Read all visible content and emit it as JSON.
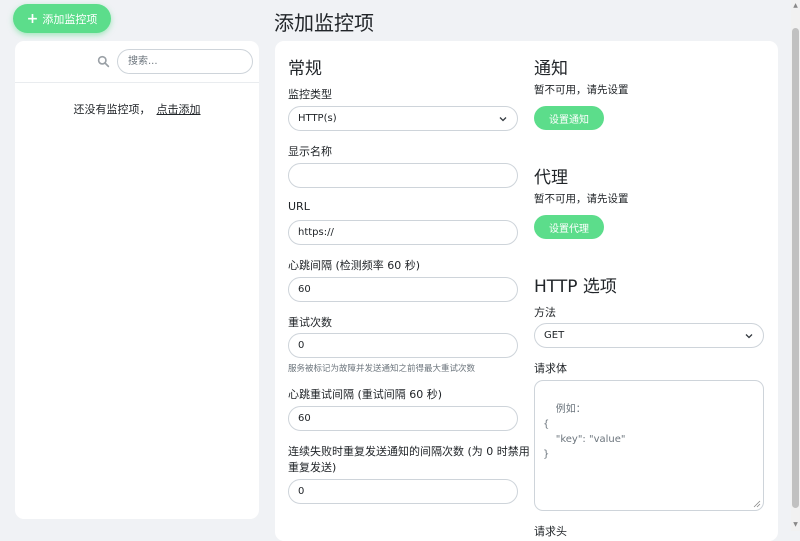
{
  "add_button": {
    "icon": "plus-icon",
    "label": "添加监控项"
  },
  "sidebar": {
    "search_placeholder": "搜索...",
    "empty_text": "还没有监控项，",
    "empty_link": "点击添加"
  },
  "page_title": "添加监控项",
  "general": {
    "heading": "常规",
    "monitor_type": {
      "label": "监控类型",
      "value": "HTTP(s)"
    },
    "display_name": {
      "label": "显示名称",
      "value": ""
    },
    "url": {
      "label": "URL",
      "value": "https://"
    },
    "interval": {
      "label": "心跳间隔 (检测频率 60 秒)",
      "value": "60"
    },
    "retries": {
      "label": "重试次数",
      "value": "0",
      "help": "服务被标记为故障并发送通知之前得最大重试次数"
    },
    "retry_interval": {
      "label": "心跳重试间隔 (重试间隔 60 秒)",
      "value": "60"
    },
    "resend": {
      "label_line1": "连续失败时重复发送通知的间隔次数 (为 0 时禁用",
      "label_line2": "重复发送)",
      "value": "0"
    }
  },
  "notifications": {
    "heading": "通知",
    "status": "暂不可用，请先设置",
    "button": "设置通知"
  },
  "proxy": {
    "heading": "代理",
    "status": "暂不可用，请先设置",
    "button": "设置代理"
  },
  "http_options": {
    "heading": "HTTP 选项",
    "method": {
      "label": "方法",
      "value": "GET"
    },
    "body": {
      "label": "请求体",
      "placeholder": "例如：\n{\n    \"key\": \"value\"\n}"
    },
    "headers_label": "请求头"
  },
  "colors": {
    "accent": "#5cdd8b",
    "background": "#f0f2f5",
    "panel": "#ffffff"
  }
}
